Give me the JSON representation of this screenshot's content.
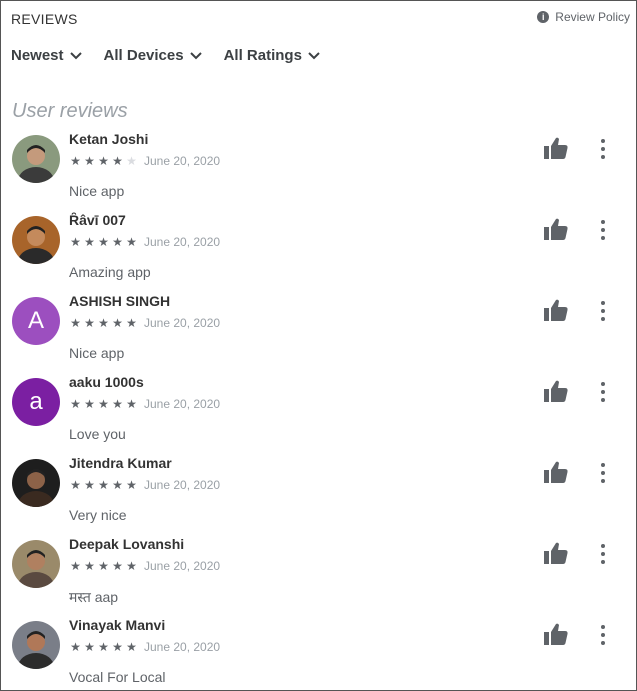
{
  "header": {
    "title": "REVIEWS",
    "policy_label": "Review Policy"
  },
  "filters": [
    {
      "label": "Newest"
    },
    {
      "label": "All Devices"
    },
    {
      "label": "All Ratings"
    }
  ],
  "section_title": "User reviews",
  "colors": {
    "accent_purple": "#9c4fbf",
    "accent_deep_purple": "#7b1fa2",
    "star": "#5f6368",
    "star_off": "#dadce0"
  },
  "reviews": [
    {
      "name": "Ketan Joshi",
      "rating": 4,
      "date": "June 20, 2020",
      "text": "Nice app",
      "avatar": {
        "type": "photo"
      }
    },
    {
      "name": "Ȓâvī 007",
      "rating": 5,
      "date": "June 20, 2020",
      "text": "Amazing app",
      "avatar": {
        "type": "photo"
      }
    },
    {
      "name": "ASHISH SINGH",
      "rating": 5,
      "date": "June 20, 2020",
      "text": "Nice app",
      "avatar": {
        "type": "letter",
        "letter": "A",
        "color": "#9c4fbf"
      }
    },
    {
      "name": "aaku 1000s",
      "rating": 5,
      "date": "June 20, 2020",
      "text": "Love you",
      "avatar": {
        "type": "letter",
        "letter": "a",
        "color": "#7b1fa2"
      }
    },
    {
      "name": "Jitendra Kumar",
      "rating": 5,
      "date": "June 20, 2020",
      "text": "Very nice",
      "avatar": {
        "type": "photo"
      }
    },
    {
      "name": "Deepak Lovanshi",
      "rating": 5,
      "date": "June 20, 2020",
      "text": "मस्त aap",
      "avatar": {
        "type": "photo"
      }
    },
    {
      "name": "Vinayak Manvi",
      "rating": 5,
      "date": "June 20, 2020",
      "text": "Vocal For Local",
      "avatar": {
        "type": "photo"
      }
    }
  ]
}
